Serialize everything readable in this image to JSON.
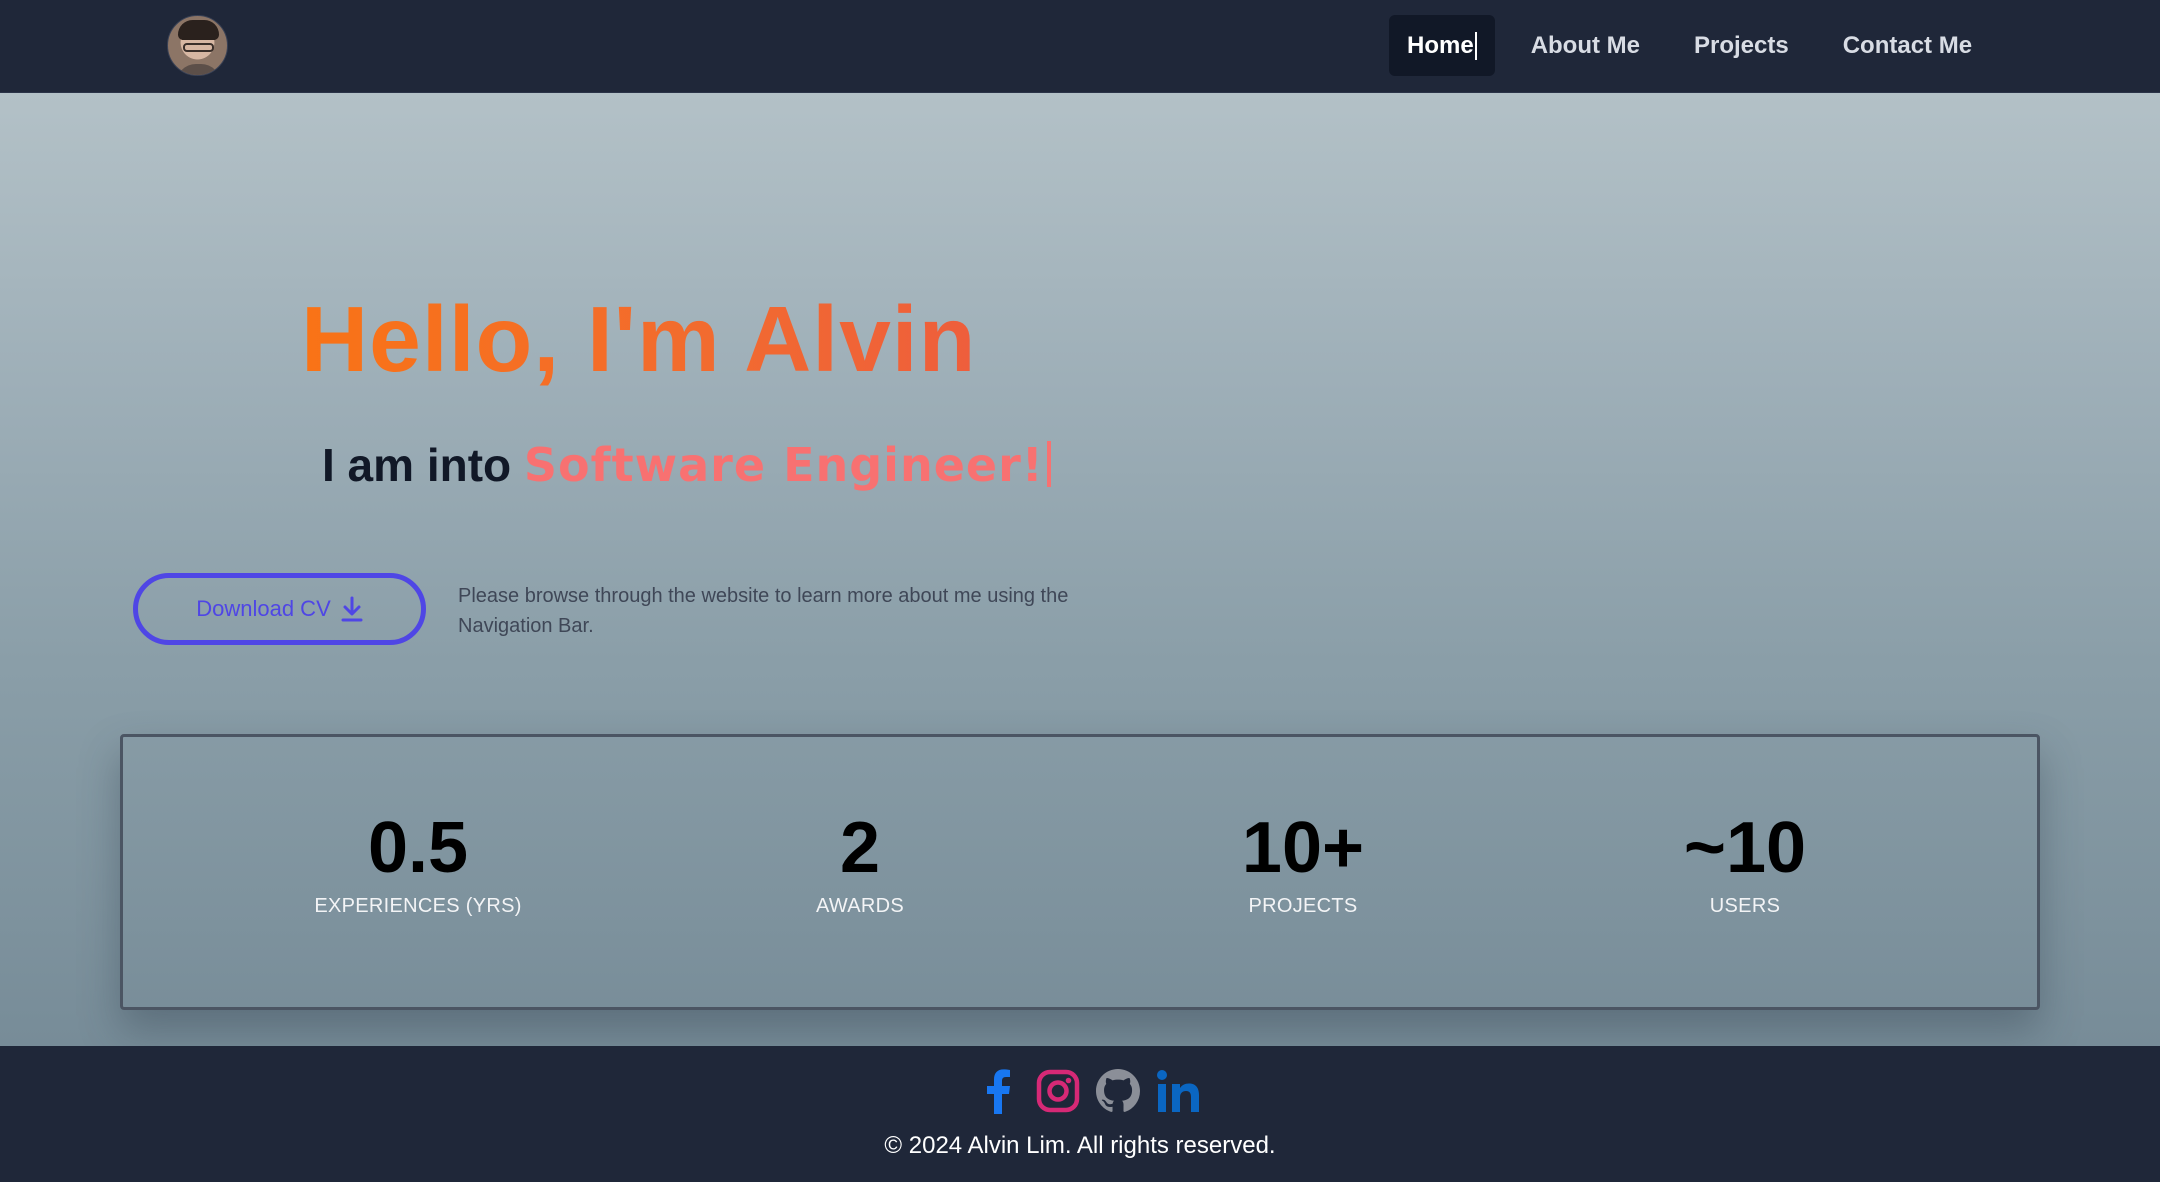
{
  "nav": {
    "links": [
      {
        "label": "Home",
        "active": true
      },
      {
        "label": "About Me",
        "active": false
      },
      {
        "label": "Projects",
        "active": false
      },
      {
        "label": "Contact Me",
        "active": false
      }
    ]
  },
  "hero": {
    "title": "Hello, I'm Alvin",
    "subtitle_prefix": "I am into",
    "subtitle_typed": "Software Engineer!",
    "download_label": "Download CV",
    "browse_text": "Please browse through the website to learn more about me using the Navigation Bar."
  },
  "stats": [
    {
      "value": "0.5",
      "label": "EXPERIENCES (YRS)"
    },
    {
      "value": "2",
      "label": "AWARDS"
    },
    {
      "value": "10+",
      "label": "PROJECTS"
    },
    {
      "value": "~10",
      "label": "USERS"
    }
  ],
  "footer": {
    "social_icons": [
      "facebook-icon",
      "instagram-icon",
      "github-icon",
      "linkedin-icon"
    ],
    "copyright": "© 2024 Alvin Lim. All rights reserved."
  },
  "colors": {
    "accent_orange": "#f97316",
    "typed_text": "#f87171",
    "button_indigo": "#4f46e5",
    "nav_bg": "#1f2739"
  }
}
